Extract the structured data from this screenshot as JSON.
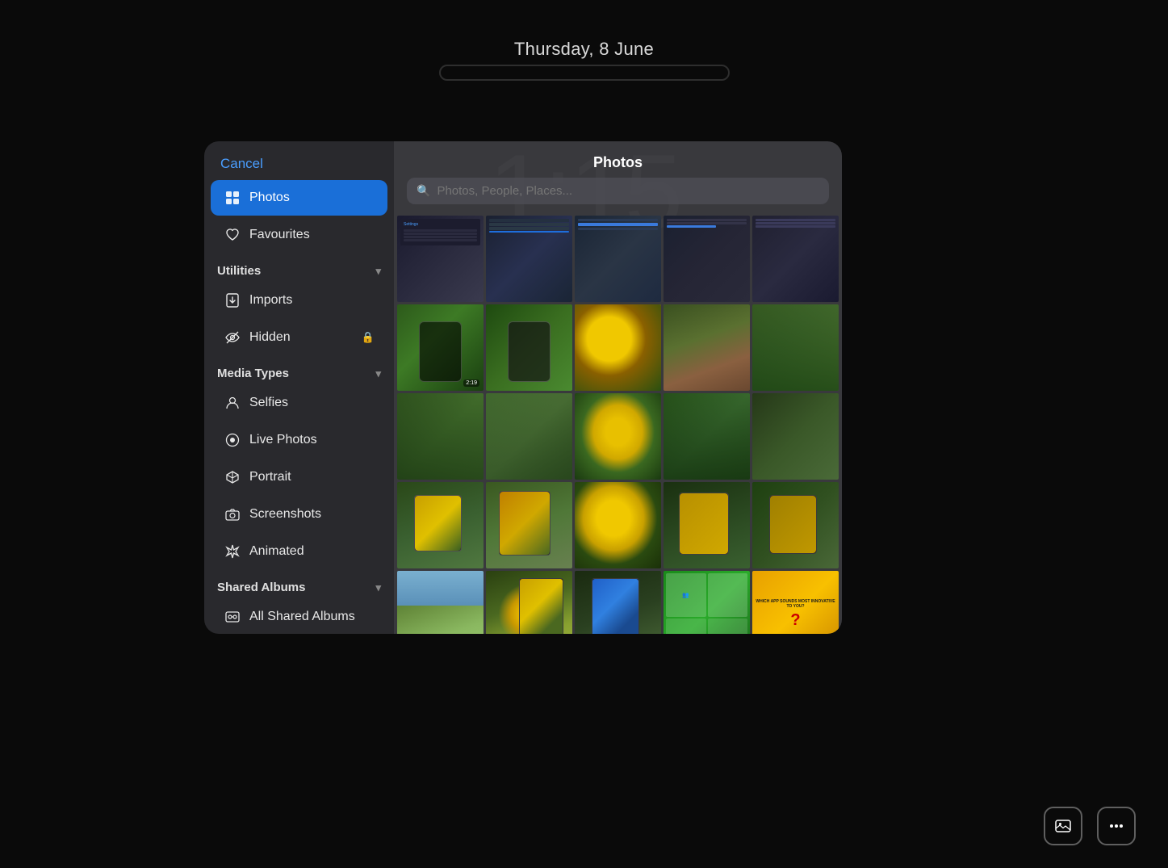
{
  "lockscreen": {
    "date": "Thursday, 8 June",
    "time": "1:15",
    "bg_color": "#0a0a0a"
  },
  "modal": {
    "title": "Photos",
    "search_placeholder": "Photos, People, Places...",
    "sidebar": {
      "cancel_label": "Cancel",
      "items": [
        {
          "id": "photos",
          "label": "Photos",
          "icon": "grid",
          "active": true
        },
        {
          "id": "favourites",
          "label": "Favourites",
          "icon": "heart",
          "active": false
        }
      ],
      "sections": [
        {
          "id": "utilities",
          "label": "Utilities",
          "expanded": true,
          "items": [
            {
              "id": "imports",
              "label": "Imports",
              "icon": "import",
              "active": false
            },
            {
              "id": "hidden",
              "label": "Hidden",
              "icon": "eye-slash",
              "active": false,
              "has_lock": true
            }
          ]
        },
        {
          "id": "media_types",
          "label": "Media Types",
          "expanded": true,
          "items": [
            {
              "id": "selfies",
              "label": "Selfies",
              "icon": "person",
              "active": false
            },
            {
              "id": "live_photos",
              "label": "Live Photos",
              "icon": "circle-dot",
              "active": false
            },
            {
              "id": "portrait",
              "label": "Portrait",
              "icon": "cube",
              "active": false
            },
            {
              "id": "screenshots",
              "label": "Screenshots",
              "icon": "camera",
              "active": false
            },
            {
              "id": "animated",
              "label": "Animated",
              "icon": "asterisk",
              "active": false
            }
          ]
        },
        {
          "id": "shared_albums",
          "label": "Shared Albums",
          "expanded": true,
          "items": [
            {
              "id": "all_shared",
              "label": "All Shared Albums",
              "icon": "shared",
              "active": false
            }
          ]
        }
      ]
    }
  },
  "bottom_bar": {
    "icon1": "photo",
    "icon2": "ellipsis"
  }
}
